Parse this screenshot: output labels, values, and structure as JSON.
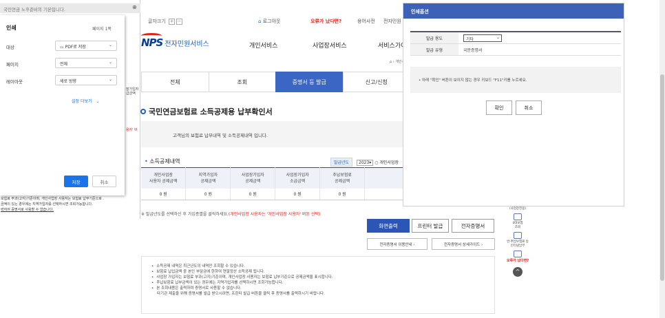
{
  "topbar": {
    "font_size_label": "글자크기",
    "font_plus": "+",
    "font_minus": "−",
    "logout": "로그아웃",
    "error_link": "오류가 났다면?",
    "dictionary": "용어사전",
    "e_civil": "전자민원"
  },
  "logo": {
    "brand": "NPS",
    "service": "전자민원서비스"
  },
  "gnb": [
    "개인서비스",
    "사업장서비스",
    "서비스가이"
  ],
  "breadcrumb": "개인서",
  "tabs": [
    {
      "label": "전체",
      "active": false
    },
    {
      "label": "조회",
      "active": false
    },
    {
      "label": "증명서 등 발급",
      "active": true
    },
    {
      "label": "신고/신청",
      "active": false
    }
  ],
  "page_title": "국민연금보험료 소득공제용 납부확인서",
  "info_text": "고객님의 보험료 납부내역 및 소득공제내역 입니다.",
  "section": {
    "title": "소득공제내역",
    "year_badge": "발급년도",
    "year_value": "2023",
    "radio_label": "○ 개인사업장"
  },
  "table": {
    "headers": [
      "개인사업장\n사용자 공제금액",
      "지역가입자\n공제금액",
      "사업장가입자\n공제금액",
      "사업장가입자\n소급금액",
      "추납보험료\n공제금액",
      ""
    ],
    "row": [
      "0 원",
      "0 원",
      "0 원",
      "0 원",
      "0 원",
      ""
    ]
  },
  "note_line": {
    "prefix": "※ 발급년도를 선택하신 후 가입종별을 클릭하세요.",
    "red": "(개인사업장 사용자는 '개인사업장 사용자' 버튼 선택)"
  },
  "buttons": {
    "screen_print": "화면출력",
    "printer_issue": "프린터 발급",
    "e_cert": "전자증명서",
    "e_cert_guide": "전자증명서 이용안내  ›",
    "e_cert_detail": "전자증명서 상세가이드  ›"
  },
  "notes": [
    "소득공제 내역은 최근년도의 내역만 조회할 수 있습니다.",
    "보험료 납입금액 중 본인 부담금에 한하여 연말정산 소득공제 됩니다.",
    "사업장 가입자는 보험료 부과(고지)기준이며, 개인사업장 사용자는 보험료 납부기준으로 공제금액을 표시합니다.",
    "추납보험료 납부금액이 있는 경우에는 지역가입자를 선택하시면 조회가능합니다.",
    "본 조회내용은 출력하여 증명서로 사용할 수 없습니다.",
    "타기관 제출을 위해 증명서를 발급 받으시려면, 프린터 발급 버튼을 클릭 후 증명서를 출력하시기 바랍니다."
  ],
  "quick": {
    "top_label": "(사업장전용)",
    "item1": "4대보험\n조회",
    "item2": "반.추납보험료 등\n인터넷납부",
    "error": "오류가 났다면?",
    "up": "^"
  },
  "left": {
    "search_text": "국민연금 노후준비의 기본입니다.",
    "dialog_title": "인쇄",
    "pages_count": "페이지 1쪽",
    "rows": [
      {
        "label": "대상",
        "value": "PDF로 저장"
      },
      {
        "label": "페이지",
        "value": "전체"
      },
      {
        "label": "레이아웃",
        "value": "세로 방향"
      }
    ],
    "more_settings": "설정 더보기",
    "save": "저장",
    "cancel": "취소",
    "col_text_1": "장가입자",
    "col_text_2": "급금액",
    "col_red": "용자' 버",
    "bottom_1": "보험료 부과(고지)기준이며, 개인사업장 사용자는 보험료 납부기준으로 .",
    "bottom_2": "금액이 있는 경우에는 지역가입자를 선택하시면 조회가능합니다.",
    "bottom_3": "력하여 증명서로 사용할 수 없습니다."
  },
  "popup": {
    "title": "인쇄옵션",
    "purpose_label": "발급 용도",
    "purpose_value": "기타",
    "type_label": "발급 유형",
    "type_value": "국문증명서",
    "note": "•  아래 \"확인\" 버튼이 보이지 않는 경우 키보드 \"F11\"키를 누르세요.",
    "confirm": "확인",
    "cancel": "취소"
  },
  "colors": {
    "primary": "#3b66c3",
    "popup_header": "#3c61b7",
    "error_red": "#e2231a",
    "chrome_blue": "#1a73e8"
  }
}
